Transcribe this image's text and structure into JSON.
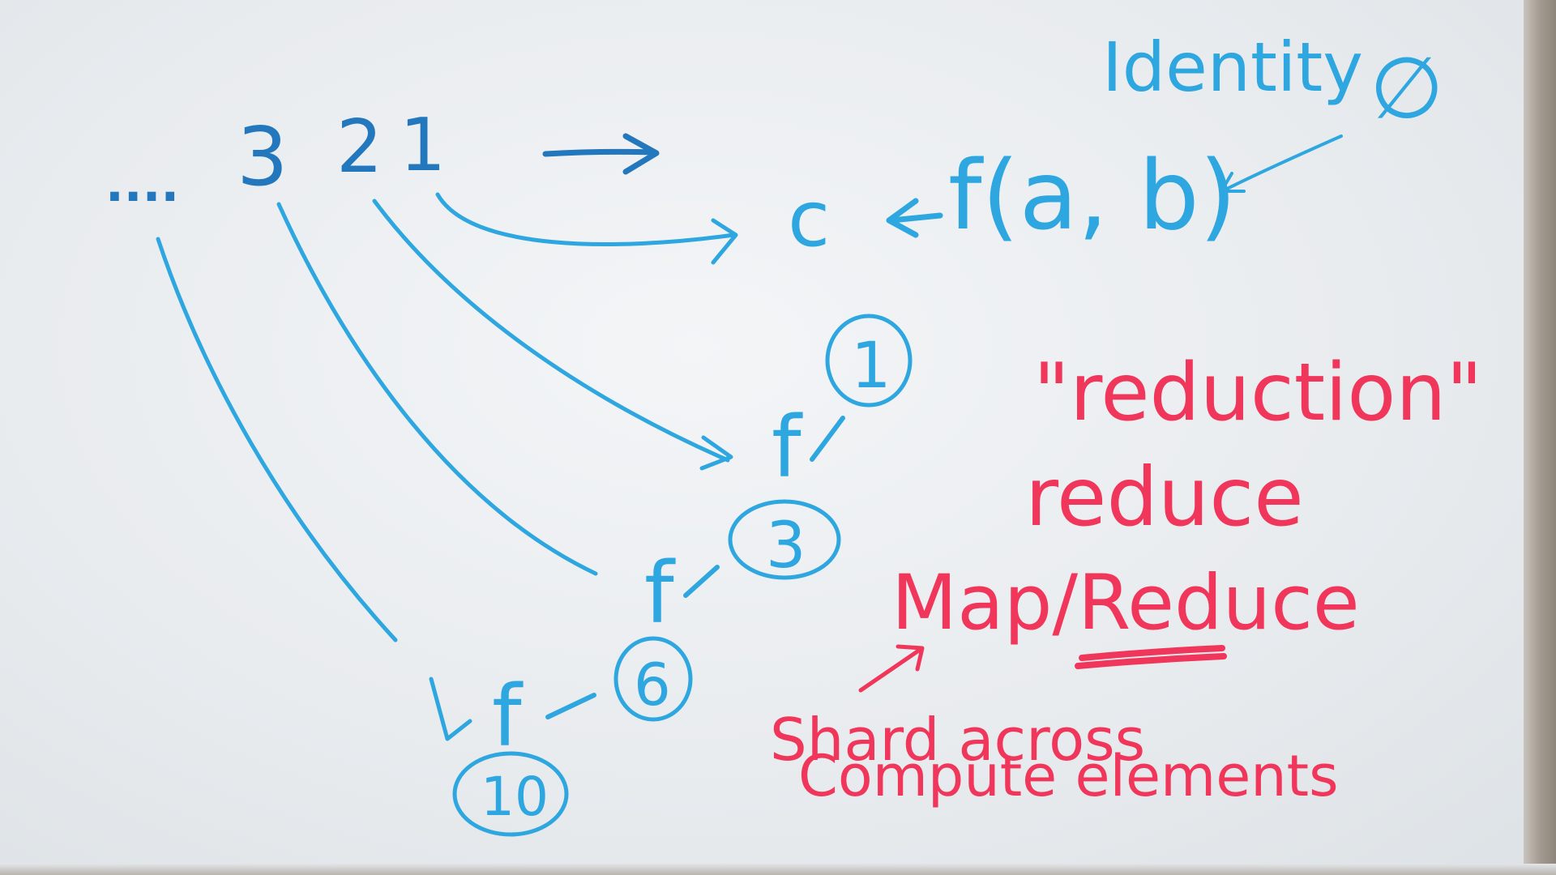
{
  "sequence": {
    "dots": "....",
    "three": "3",
    "two": "2",
    "one": "1"
  },
  "equation": {
    "c": "c",
    "expr": "f(a, b)"
  },
  "identity": {
    "label": "Identity",
    "symbol": "∅"
  },
  "tree": {
    "f_label": "f",
    "nodes": [
      "1",
      "3",
      "6",
      "10"
    ]
  },
  "terms": {
    "reduction": "\"reduction\"",
    "reduce": "reduce",
    "map_reduce": "Map/Reduce"
  },
  "note": {
    "line1": "Shard across",
    "line2": "Compute elements"
  },
  "colors": {
    "blue_marker": "#2ea6df",
    "dark_blue_marker": "#2378bd",
    "red_marker": "#f0365a",
    "board": "#eef1f4"
  }
}
